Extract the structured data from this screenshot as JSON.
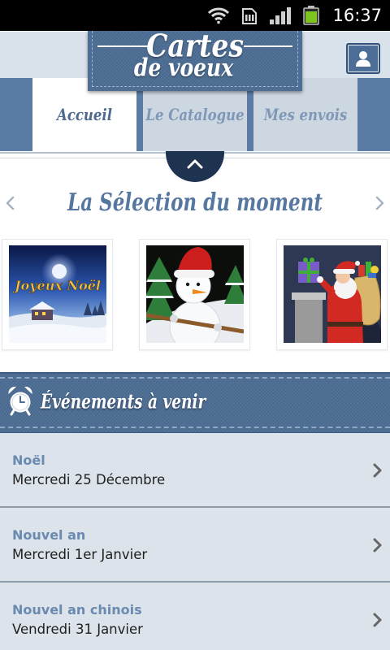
{
  "status_bar": {
    "time": "16:37",
    "icons": [
      "wifi-icon",
      "sim-data-icon",
      "signal-icon",
      "battery-icon"
    ]
  },
  "header": {
    "logo_top": "Cartes",
    "logo_bottom": "de voeux",
    "profile_icon": "user-icon"
  },
  "tabs": [
    {
      "label": "Accueil",
      "active": true
    },
    {
      "label": "Le Catalogue",
      "active": false
    },
    {
      "label": "Mes envois",
      "active": false
    }
  ],
  "collapse_icon": "chevron-up-icon",
  "selection": {
    "title": "La Sélection du moment",
    "prev_icon": "chevron-left-icon",
    "next_icon": "chevron-right-icon",
    "cards": [
      {
        "image_text": "Joyeux Noël"
      },
      {},
      {}
    ]
  },
  "events": {
    "title": "Événements à venir",
    "icon": "alarm-clock-icon",
    "items": [
      {
        "name": "Noël",
        "date": "Mercredi 25 Décembre"
      },
      {
        "name": "Nouvel an",
        "date": "Mercredi 1er Janvier"
      },
      {
        "name": "Nouvel an chinois",
        "date": "Vendredi 31 Janvier"
      }
    ],
    "item_icon": "chevron-right-icon"
  },
  "colors": {
    "accent": "#5b7ca4",
    "denim": "#4d6e95",
    "navy": "#1d3350",
    "title": "#5677a0",
    "event_name": "#6a8ab0",
    "date_text": "#1f1f1f",
    "tab_text": "#4e6b8f",
    "tab_text_inactive": "#7f98b6",
    "tab_inactive": "#cdd7e2",
    "header_bg": "#d9e2eb",
    "list_bg": "#dce3ea",
    "separator": "#8e9ba8",
    "battery": "#7cc520"
  }
}
